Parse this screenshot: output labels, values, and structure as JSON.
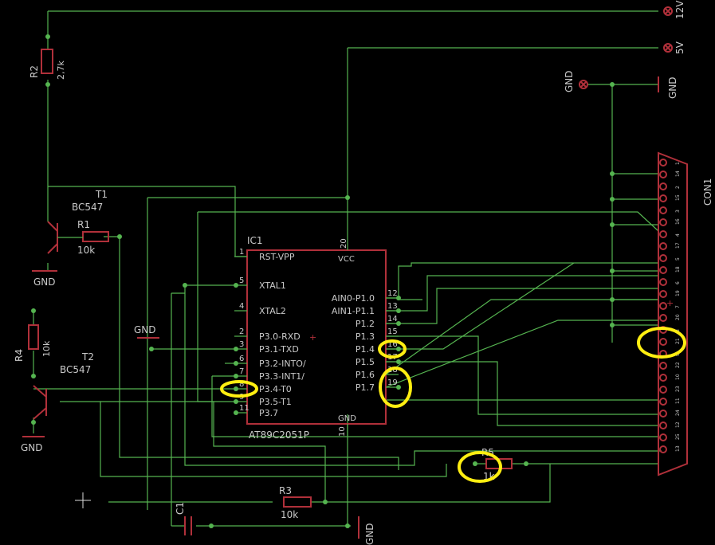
{
  "colors": {
    "background": "#000000",
    "wire": "#55b450",
    "part": "#b0303a",
    "text": "#c9c9c9",
    "highlight": "#ffee11"
  },
  "supplies": {
    "v12": "12V",
    "v5": "5V",
    "gnd_top": "GND",
    "gnd_top2": "GND"
  },
  "connector": {
    "name": "CON1",
    "pins": [
      "1",
      "2",
      "3",
      "4",
      "5",
      "6",
      "7",
      "8",
      "9",
      "10",
      "11",
      "12",
      "13",
      "14",
      "15",
      "16",
      "17",
      "18",
      "19",
      "20",
      "21",
      "22",
      "23",
      "24",
      "25"
    ]
  },
  "parts": {
    "r1": {
      "name": "R1",
      "value": "10k"
    },
    "r2": {
      "name": "R2",
      "value": "2,7k"
    },
    "r3": {
      "name": "R3",
      "value": "10k"
    },
    "r4": {
      "name": "R4",
      "value": "10k"
    },
    "r5": {
      "name": "R5",
      "value": "1k"
    },
    "t1": {
      "name": "T1",
      "value": "BC547"
    },
    "t2": {
      "name": "T2",
      "value": "BC547"
    },
    "c1": {
      "name": "C1"
    },
    "ic1": {
      "name": "IC1",
      "value": "AT89C2051P"
    }
  },
  "ic_pins_left": [
    {
      "num": "1",
      "label": "RST-VPP"
    },
    {
      "num": "5",
      "label": "XTAL1"
    },
    {
      "num": "4",
      "label": "XTAL2"
    },
    {
      "num": "2",
      "label": "P3.0-RXD"
    },
    {
      "num": "3",
      "label": "P3.1-TXD"
    },
    {
      "num": "6",
      "label": "P3.2-INTO/"
    },
    {
      "num": "7",
      "label": "P3.3-INT1/"
    },
    {
      "num": "8",
      "label": "P3.4-T0"
    },
    {
      "num": "9",
      "label": "P3.5-T1"
    },
    {
      "num": "11",
      "label": "P3.7"
    }
  ],
  "ic_pins_right": [
    {
      "num": "12",
      "label": "AIN0-P1.0"
    },
    {
      "num": "13",
      "label": "AIN1-P1.1"
    },
    {
      "num": "14",
      "label": "P1.2"
    },
    {
      "num": "15",
      "label": "P1.3"
    },
    {
      "num": "16",
      "label": "P1.4"
    },
    {
      "num": "17",
      "label": "P1.5"
    },
    {
      "num": "18",
      "label": "P1.6"
    },
    {
      "num": "19",
      "label": "P1.7"
    }
  ],
  "ic_top": {
    "num": "20",
    "label": "VCC"
  },
  "ic_bottom": {
    "num": "10",
    "label": "GND"
  },
  "grounds": [
    "GND",
    "GND",
    "GND",
    "GND"
  ]
}
